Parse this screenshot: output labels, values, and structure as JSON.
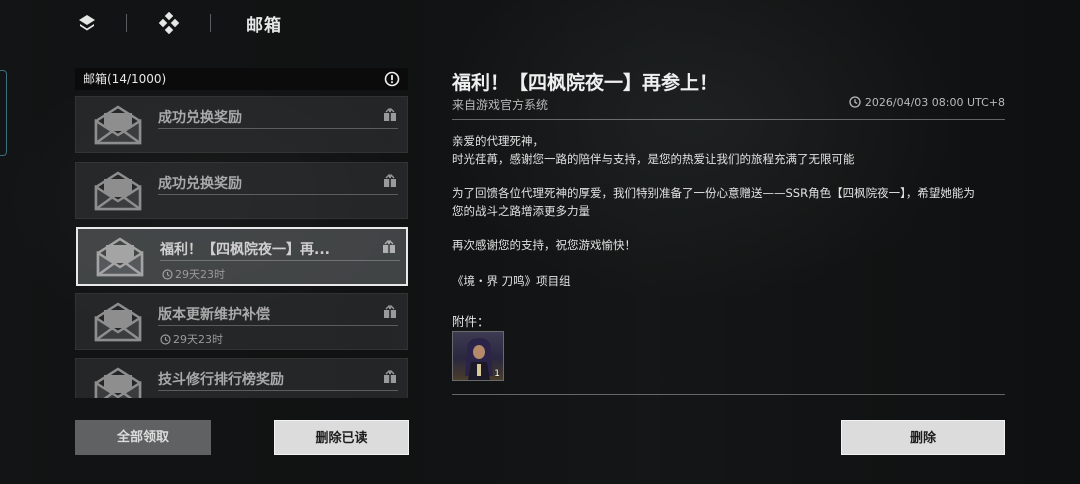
{
  "header": {
    "title": "邮箱",
    "nav_icons": [
      "layers-icon",
      "diamond-grid-icon"
    ]
  },
  "mail_list": {
    "header_label": "邮箱(14/1000)",
    "info_icon": "exclamation-circle-icon",
    "items": [
      {
        "title": "成功兑换奖励",
        "timer": "",
        "selected": false
      },
      {
        "title": "成功兑换奖励",
        "timer": "",
        "selected": false
      },
      {
        "title": "福利！【四枫院夜一】再...",
        "timer": "29天23时",
        "selected": true
      },
      {
        "title": "版本更新维护补偿",
        "timer": "29天23时",
        "selected": false
      },
      {
        "title": "技斗修行排行榜奖励",
        "timer": "",
        "selected": false
      }
    ]
  },
  "buttons": {
    "claim_all": "全部领取",
    "delete_read": "删除已读",
    "delete": "删除"
  },
  "detail": {
    "title": "福利！【四枫院夜一】再参上！",
    "sender": "来自游戏官方系统",
    "date": "2026/04/03 08:00 UTC+8",
    "body": [
      "亲爱的代理死神，",
      "时光荏苒，感谢您一路的陪伴与支持，是您的热爱让我们的旅程充满了无限可能",
      "为了回馈各位代理死神的厚爱，我们特别准备了一份心意赠送——SSR角色【四枫院夜一】，希望她能为",
      "您的战斗之路增添更多力量",
      "再次感谢您的支持，祝您游戏愉快！",
      "《境・界 刀鸣》项目组"
    ],
    "attachments_label": "附件：",
    "attachment_count": "1"
  },
  "colors": {
    "panel_bg": "#0b0b0b",
    "button_light": "#dcdcdc",
    "button_dark": "#5f6163",
    "selected_border": "#e9e9e9"
  }
}
